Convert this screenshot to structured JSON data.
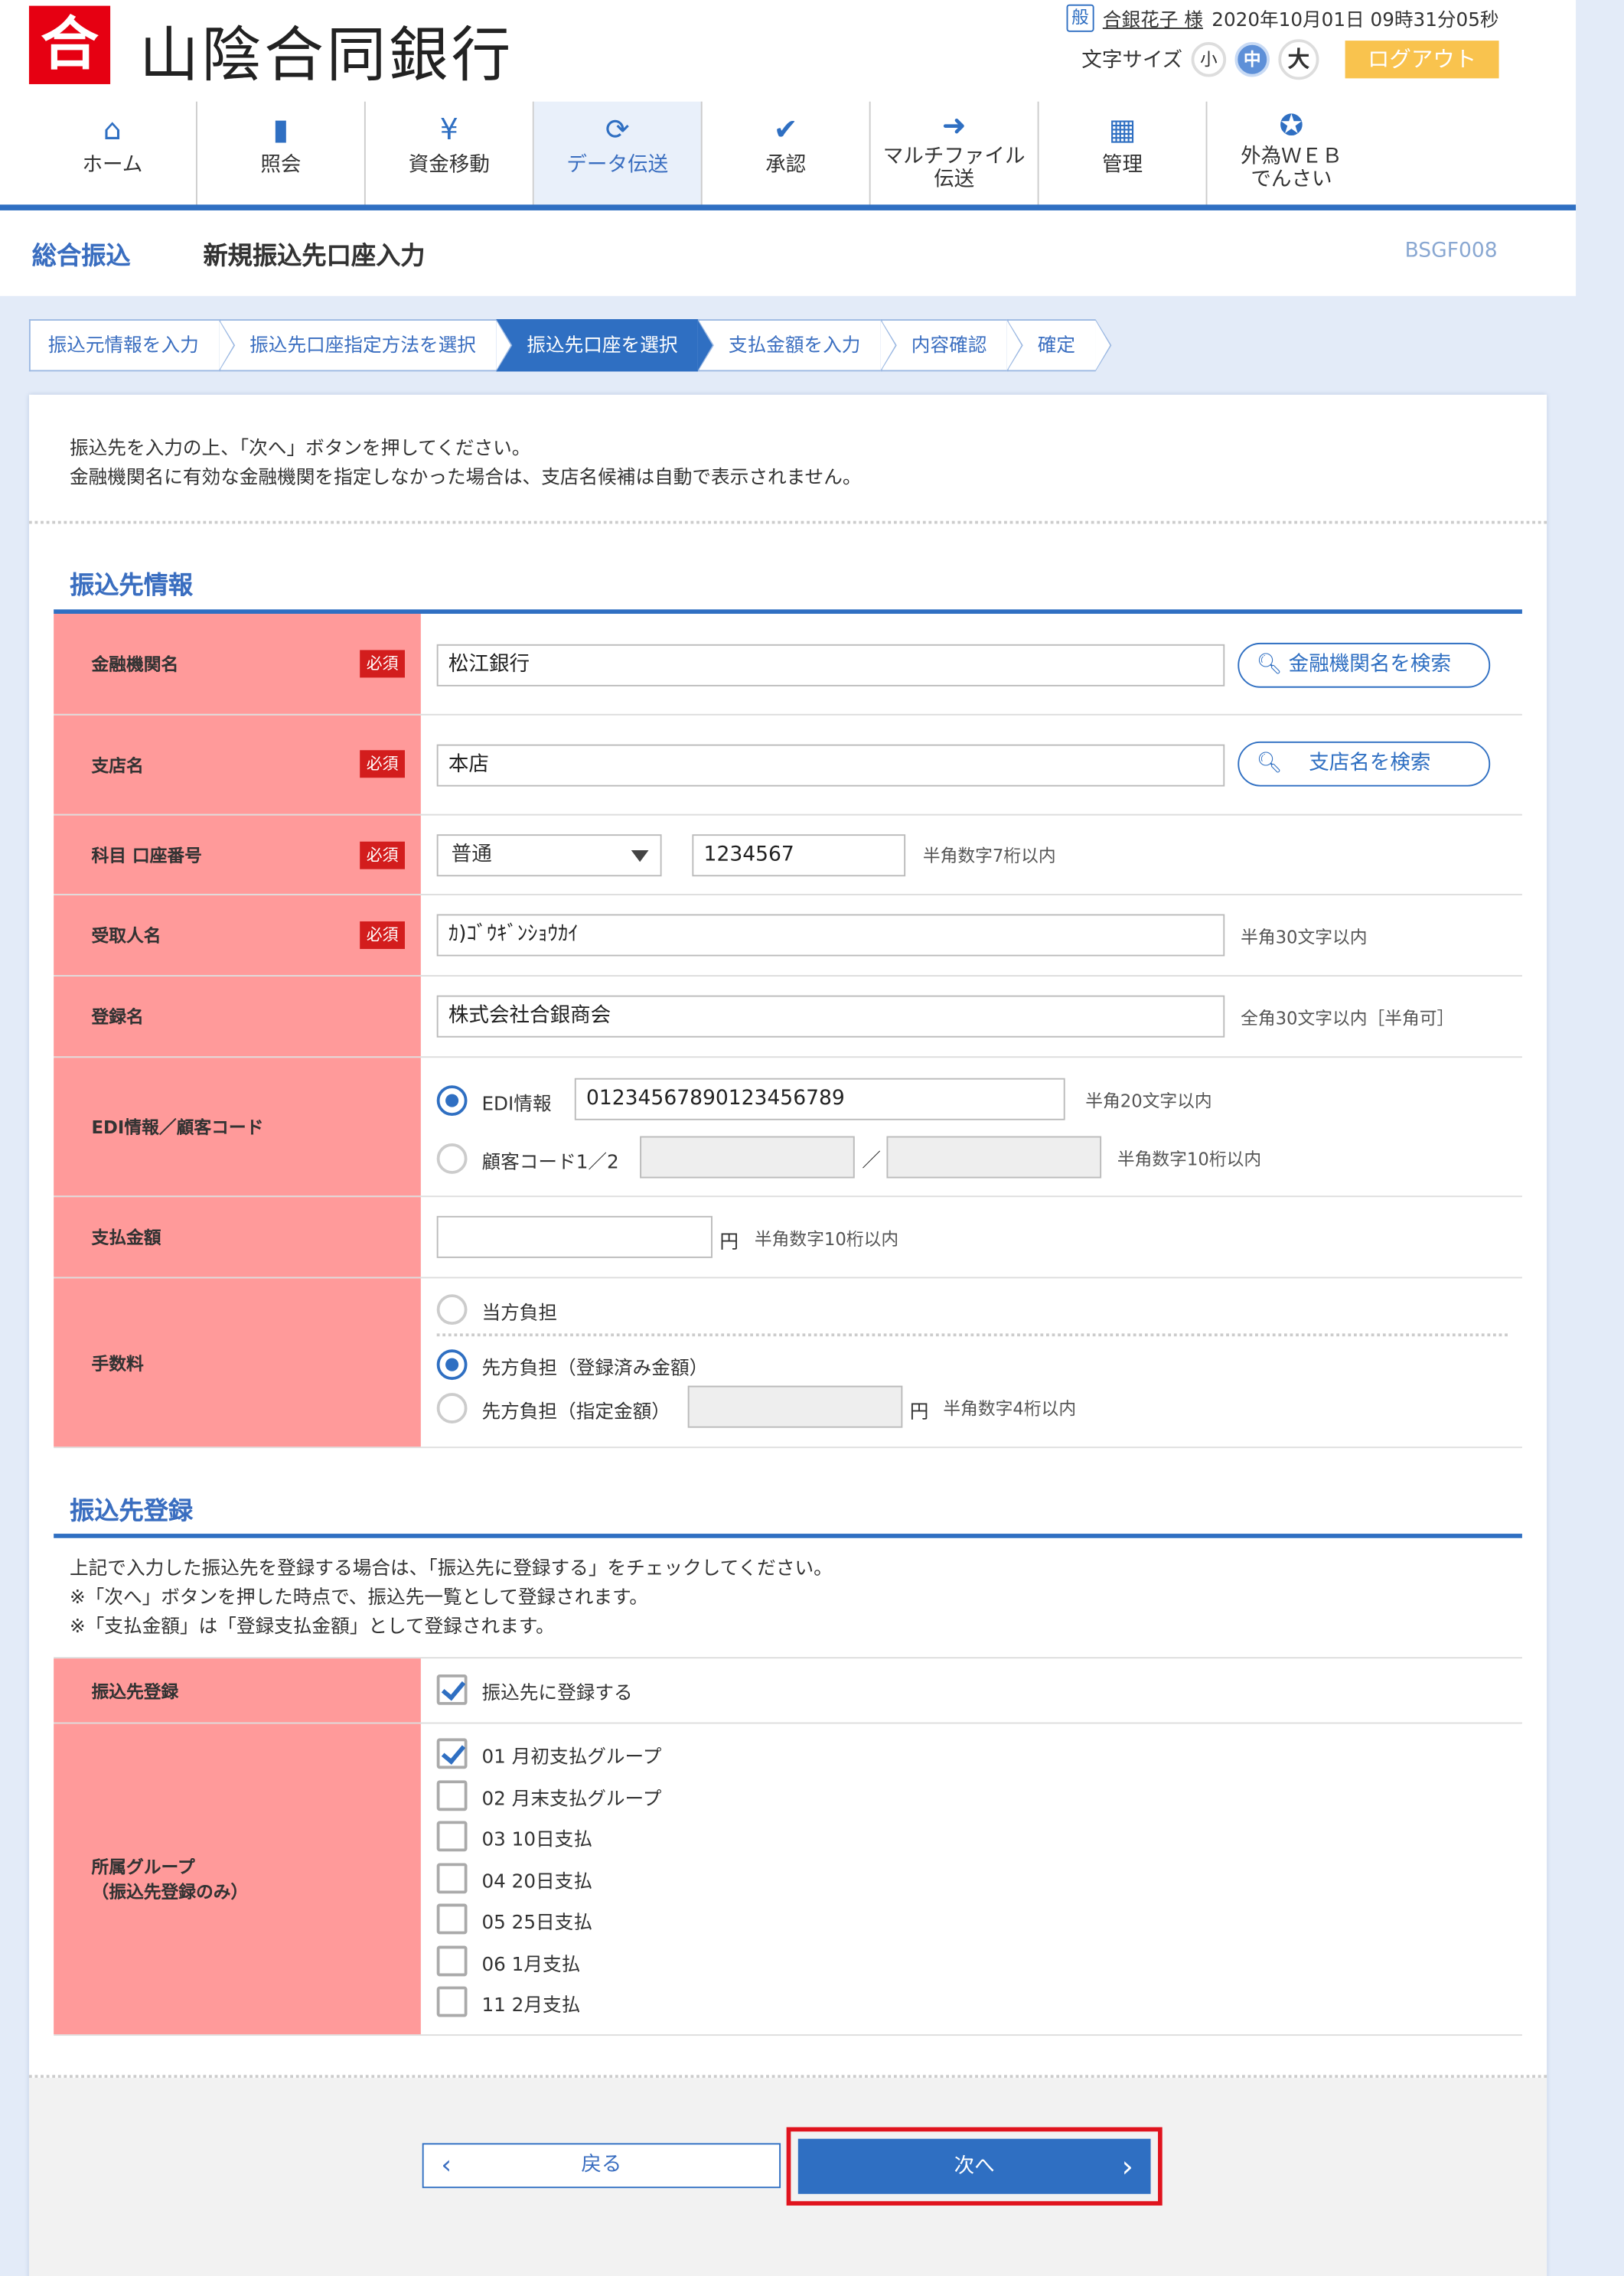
{
  "header": {
    "logo_mark": "合",
    "bank_name": "山陰合同銀行",
    "user_badge": "般",
    "user_name": "合銀花子 様",
    "datetime": "2020年10月01日 09時31分05秒",
    "font_size_label": "文字サイズ",
    "font_small": "小",
    "font_mid": "中",
    "font_large": "大",
    "logout": "ログアウト"
  },
  "nav": [
    {
      "label": "ホーム",
      "icon": "home-icon"
    },
    {
      "label": "照会",
      "icon": "document-icon"
    },
    {
      "label": "資金移動",
      "icon": "yen-transfer-icon"
    },
    {
      "label": "データ伝送",
      "icon": "sync-icon"
    },
    {
      "label": "承認",
      "icon": "approve-icon"
    },
    {
      "label": "マルチファイル",
      "label2": "伝送",
      "icon": "file-send-icon"
    },
    {
      "label": "管理",
      "icon": "manage-icon"
    },
    {
      "label": "外為ＷＥＢ",
      "label2": "でんさい",
      "icon": "fx-icon"
    }
  ],
  "page": {
    "category": "総合振込",
    "title": "新規振込先口座入力",
    "code": "BSGF008"
  },
  "steps": [
    "振込元情報を入力",
    "振込先口座指定方法を選択",
    "振込先口座を選択",
    "支払金額を入力",
    "内容確認",
    "確定"
  ],
  "intro": [
    "振込先を入力の上、「次へ」ボタンを押してください。",
    "金融機関名に有効な金融機関を指定しなかった場合は、支店名候補は自動で表示されません。"
  ],
  "payee": {
    "section": "振込先情報",
    "required": "必須",
    "bank_label": "金融機関名",
    "bank_value": "松江銀行",
    "bank_search": "金融機関名を検索",
    "branch_label": "支店名",
    "branch_value": "本店",
    "branch_search": "支店名を検索",
    "acct_label": "科目 口座番号",
    "acct_type": "普通",
    "acct_no": "1234567",
    "acct_note": "半角数字7桁以内",
    "recv_label": "受取人名",
    "recv_value": "ｶ)ｺﾞｳｷﾞﾝｼｮｳｶｲ",
    "recv_note": "半角30文字以内",
    "regname_label": "登録名",
    "regname_value": "株式会社合銀商会",
    "regname_note": "全角30文字以内［半角可］",
    "edi_label": "EDI情報／顧客コード",
    "edi_opt": "EDI情報",
    "edi_value": "01234567890123456789",
    "edi_note": "半角20文字以内",
    "cust_opt": "顧客コード1／2",
    "cust_sep": "／",
    "cust_note": "半角数字10桁以内",
    "amount_label": "支払金額",
    "amount_unit": "円",
    "amount_note": "半角数字10桁以内",
    "fee_label": "手数料",
    "fee_opt1": "当方負担",
    "fee_opt2": "先方負担（登録済み金額）",
    "fee_opt3": "先方負担（指定金額）",
    "fee_unit": "円",
    "fee_note": "半角数字4桁以内"
  },
  "register": {
    "section": "振込先登録",
    "desc": [
      "上記で入力した振込先を登録する場合は、「振込先に登録する」をチェックしてください。",
      "※「次へ」ボタンを押した時点で、振込先一覧として登録されます。",
      "※「支払金額」は「登録支払金額」として登録されます。"
    ],
    "reg_label": "振込先登録",
    "reg_check": "振込先に登録する",
    "group_label": "所属グループ",
    "group_label2": "（振込先登録のみ）",
    "groups": [
      {
        "label": "01 月初支払グループ",
        "checked": true
      },
      {
        "label": "02 月末支払グループ",
        "checked": false
      },
      {
        "label": "03 10日支払",
        "checked": false
      },
      {
        "label": "04 20日支払",
        "checked": false
      },
      {
        "label": "05 25日支払",
        "checked": false
      },
      {
        "label": "06 1月支払",
        "checked": false
      },
      {
        "label": "11 2月支払",
        "checked": false
      }
    ]
  },
  "buttons": {
    "back": "戻る",
    "next": "次へ",
    "back_arrow": "‹",
    "next_arrow": "›"
  }
}
